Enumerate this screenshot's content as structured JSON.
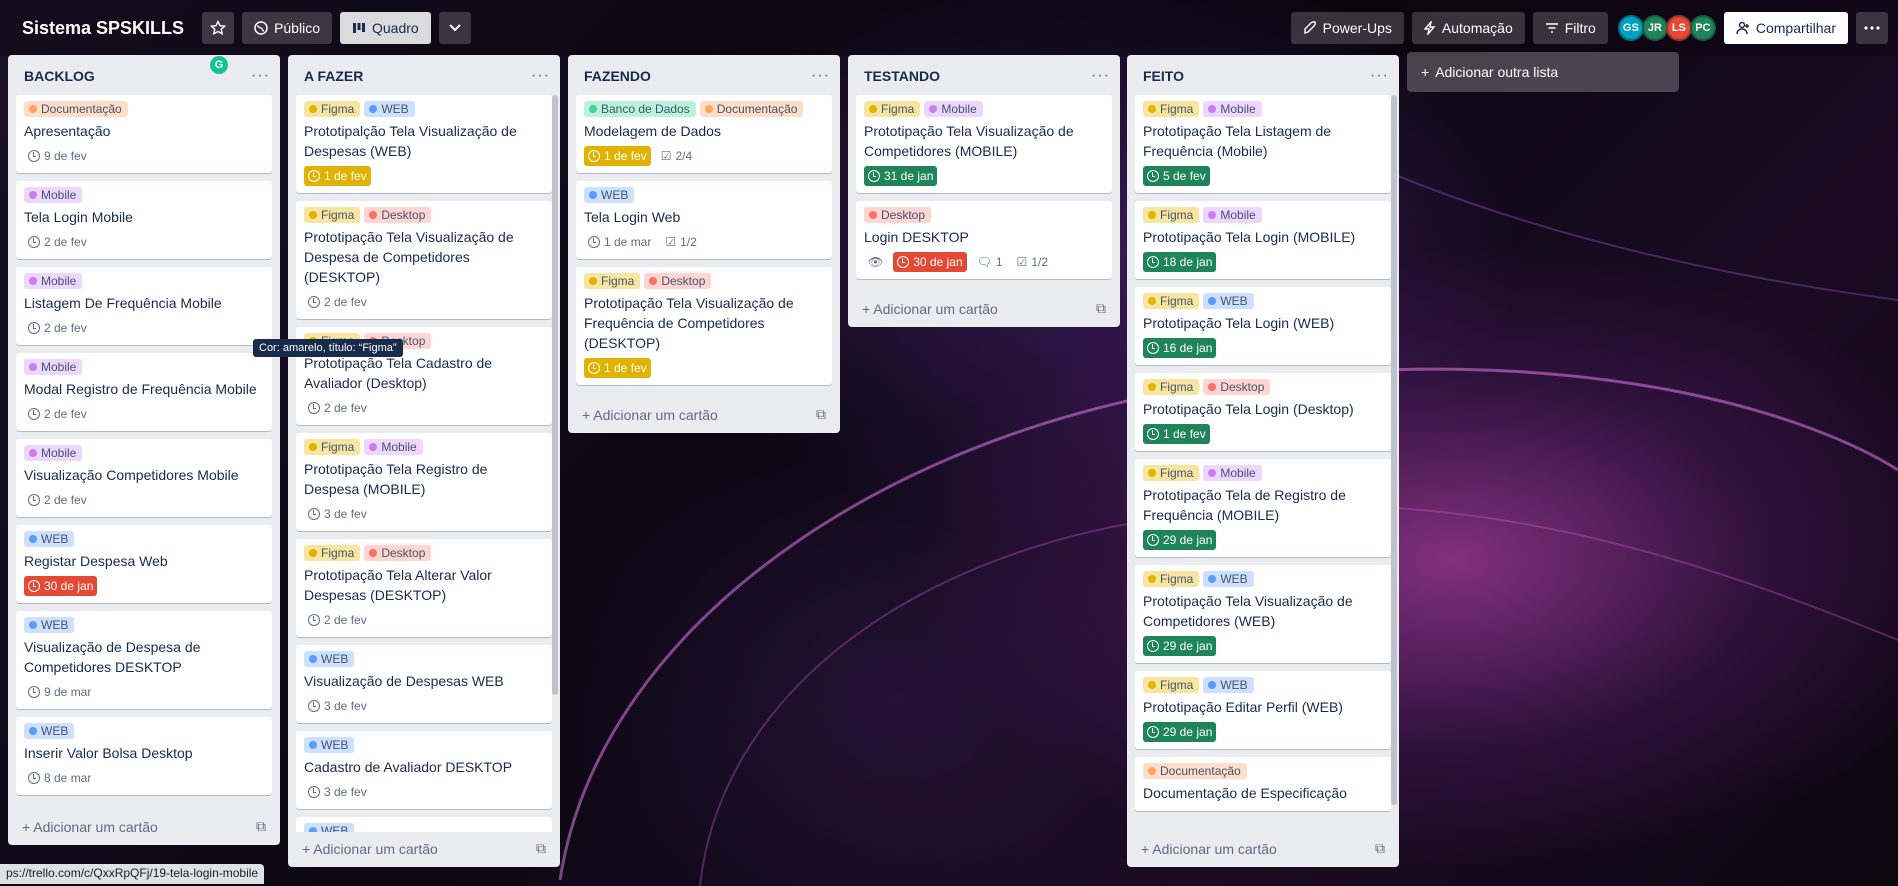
{
  "topbar": {
    "board_title": "Sistema SPSKILLS",
    "visibility_label": "Público",
    "view_label": "Quadro",
    "powerups_label": "Power-Ups",
    "automation_label": "Automação",
    "filter_label": "Filtro",
    "share_label": "Compartilhar",
    "members": [
      {
        "initials": "GS",
        "color": "#00a3bf"
      },
      {
        "initials": "JR",
        "color": "#1f845a"
      },
      {
        "initials": "LS",
        "color": "#e34935"
      },
      {
        "initials": "PC",
        "color": "#1f845a"
      }
    ]
  },
  "label_colors": {
    "Documentação": {
      "bg": "#fedec8",
      "dot": "#fea362"
    },
    "Mobile": {
      "bg": "#eed7fc",
      "dot": "#c97cf4"
    },
    "WEB": {
      "bg": "#cce0ff",
      "dot": "#579dff"
    },
    "Figma": {
      "bg": "#f8e6a0",
      "dot": "#e2b203"
    },
    "Desktop": {
      "bg": "#ffd5d2",
      "dot": "#f87168"
    },
    "Banco de Dados": {
      "bg": "#baf3db",
      "dot": "#4bce97"
    }
  },
  "add_card_label": "Adicionar um cartão",
  "add_list_label": "Adicionar outra lista",
  "tooltip": "Cor: amarelo, título: “Figma”",
  "status_url": "ps://trello.com/c/QxxRpQFj/19-tela-login-mobile",
  "lists": [
    {
      "title": "BACKLOG",
      "cards": [
        {
          "labels": [
            "Documentação"
          ],
          "title": "Apresentação",
          "due": "9 de fev",
          "due_style": "plain"
        },
        {
          "labels": [
            "Mobile"
          ],
          "title": "Tela Login Mobile",
          "due": "2 de fev",
          "due_style": "plain"
        },
        {
          "labels": [
            "Mobile"
          ],
          "title": "Listagem De Frequência Mobile",
          "due": "2 de fev",
          "due_style": "plain"
        },
        {
          "labels": [
            "Mobile"
          ],
          "title": "Modal Registro de Frequência Mobile",
          "due": "2 de fev",
          "due_style": "plain"
        },
        {
          "labels": [
            "Mobile"
          ],
          "title": "Visualização Competidores Mobile",
          "due": "2 de fev",
          "due_style": "plain"
        },
        {
          "labels": [
            "WEB"
          ],
          "title": "Registar Despesa Web",
          "due": "30 de jan",
          "due_style": "red"
        },
        {
          "labels": [
            "WEB"
          ],
          "title": "Visualização de Despesa de Competidores DESKTOP",
          "due": "9 de mar",
          "due_style": "plain"
        },
        {
          "labels": [
            "WEB"
          ],
          "title": "Inserir Valor Bolsa Desktop",
          "due": "8 de mar",
          "due_style": "plain"
        }
      ]
    },
    {
      "title": "A FAZER",
      "cards": [
        {
          "labels": [
            "Figma",
            "WEB"
          ],
          "title": "Prototipalção Tela Visualização de Despesas (WEB)",
          "due": "1 de fev",
          "due_style": "yellow"
        },
        {
          "labels": [
            "Figma",
            "Desktop"
          ],
          "title": "Prototipação Tela Visualização de Despesa de Competidores (DESKTOP)",
          "due": "2 de fev",
          "due_style": "plain"
        },
        {
          "labels": [
            "Figma",
            "Desktop"
          ],
          "title": "Prototipação Tela Cadastro de Avaliador (Desktop)",
          "due": "2 de fev",
          "due_style": "plain"
        },
        {
          "labels": [
            "Figma",
            "Mobile"
          ],
          "title": "Prototipação Tela Registro de Despesa (MOBILE)",
          "due": "3 de fev",
          "due_style": "plain"
        },
        {
          "labels": [
            "Figma",
            "Desktop"
          ],
          "title": "Prototipação Tela Alterar Valor Despesas (DESKTOP)",
          "due": "2 de fev",
          "due_style": "plain"
        },
        {
          "labels": [
            "WEB"
          ],
          "title": "Visualização de Despesas WEB",
          "due": "3 de fev",
          "due_style": "plain"
        },
        {
          "labels": [
            "WEB"
          ],
          "title": "Cadastro de Avaliador DESKTOP",
          "due": "3 de fev",
          "due_style": "plain"
        },
        {
          "labels": [
            "WEB"
          ],
          "title": "",
          "due": "",
          "due_style": "plain"
        }
      ]
    },
    {
      "title": "FAZENDO",
      "cards": [
        {
          "labels": [
            "Banco de Dados",
            "Documentação"
          ],
          "title": "Modelagem de Dados",
          "due": "1 de fev",
          "due_style": "yellow",
          "checklist": "2/4"
        },
        {
          "labels": [
            "WEB"
          ],
          "title": "Tela Login Web",
          "due": "1 de mar",
          "due_style": "plain",
          "checklist": "1/2"
        },
        {
          "labels": [
            "Figma",
            "Desktop"
          ],
          "title": "Prototipação Tela Visualização de Frequência de Competidores (DESKTOP)",
          "due": "1 de fev",
          "due_style": "yellow"
        }
      ]
    },
    {
      "title": "TESTANDO",
      "cards": [
        {
          "labels": [
            "Figma",
            "Mobile"
          ],
          "title": "Prototipação Tela Visualização de Competidores (MOBILE)",
          "due": "31 de jan",
          "due_style": "green"
        },
        {
          "labels": [
            "Desktop"
          ],
          "title": "Login DESKTOP",
          "due": "30 de jan",
          "due_style": "red",
          "watch": true,
          "comments": "1",
          "checklist": "1/2"
        }
      ]
    },
    {
      "title": "FEITO",
      "cards": [
        {
          "labels": [
            "Figma",
            "Mobile"
          ],
          "title": "Prototipação Tela Listagem de Frequência (Mobile)",
          "due": "5 de fev",
          "due_style": "green"
        },
        {
          "labels": [
            "Figma",
            "Mobile"
          ],
          "title": "Prototipação Tela Login (MOBILE)",
          "due": "18 de jan",
          "due_style": "green"
        },
        {
          "labels": [
            "Figma",
            "WEB"
          ],
          "title": "Prototipação Tela Login (WEB)",
          "due": "16 de jan",
          "due_style": "green"
        },
        {
          "labels": [
            "Figma",
            "Desktop"
          ],
          "title": "Prototipação Tela Login (Desktop)",
          "due": "1 de fev",
          "due_style": "green"
        },
        {
          "labels": [
            "Figma",
            "Mobile"
          ],
          "title": "Prototipação Tela de Registro de Frequência (MOBILE)",
          "due": "29 de jan",
          "due_style": "green"
        },
        {
          "labels": [
            "Figma",
            "WEB"
          ],
          "title": "Prototipação Tela Visualização de Competidores (WEB)",
          "due": "29 de jan",
          "due_style": "green"
        },
        {
          "labels": [
            "Figma",
            "WEB"
          ],
          "title": "Prototipação Editar Perfil (WEB)",
          "due": "29 de jan",
          "due_style": "green"
        },
        {
          "labels": [
            "Documentação"
          ],
          "title": "Documentação de Especificação",
          "due": "",
          "due_style": "green"
        }
      ]
    }
  ]
}
